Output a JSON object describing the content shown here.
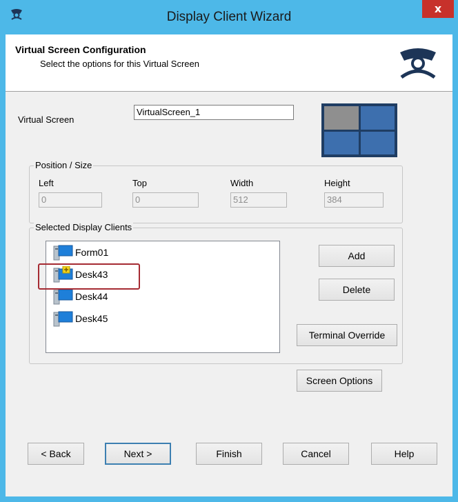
{
  "window": {
    "title": "Display Client Wizard",
    "close_label": "x"
  },
  "header": {
    "title": "Virtual Screen Configuration",
    "subtitle": "Select the options for this Virtual Screen"
  },
  "virtual_screen": {
    "label": "Virtual Screen",
    "value": "VirtualScreen_1",
    "selected_quadrant": "top-left"
  },
  "position_size": {
    "legend": "Position / Size",
    "fields": [
      {
        "label": "Left",
        "value": "0"
      },
      {
        "label": "Top",
        "value": "0"
      },
      {
        "label": "Width",
        "value": "512"
      },
      {
        "label": "Height",
        "value": "384"
      }
    ]
  },
  "selected_clients": {
    "legend": "Selected Display Clients",
    "items": [
      {
        "label": "Form01",
        "icon": "display-client-icon"
      },
      {
        "label": "Desk43",
        "icon": "display-client-primary-icon"
      },
      {
        "label": "Desk44",
        "icon": "display-client-icon"
      },
      {
        "label": "Desk45",
        "icon": "display-client-icon"
      }
    ],
    "add_label": "Add",
    "delete_label": "Delete",
    "terminal_override_label": "Terminal Override"
  },
  "screen_options_label": "Screen Options",
  "nav": {
    "back": "< Back",
    "next": "Next >",
    "finish": "Finish",
    "cancel": "Cancel",
    "help": "Help"
  },
  "colors": {
    "titlebar": "#4db8e8",
    "close": "#c7312b",
    "highlight": "#a52a32",
    "screen_selected": "#8f8f8f",
    "screen_cell": "#3d6fae"
  }
}
